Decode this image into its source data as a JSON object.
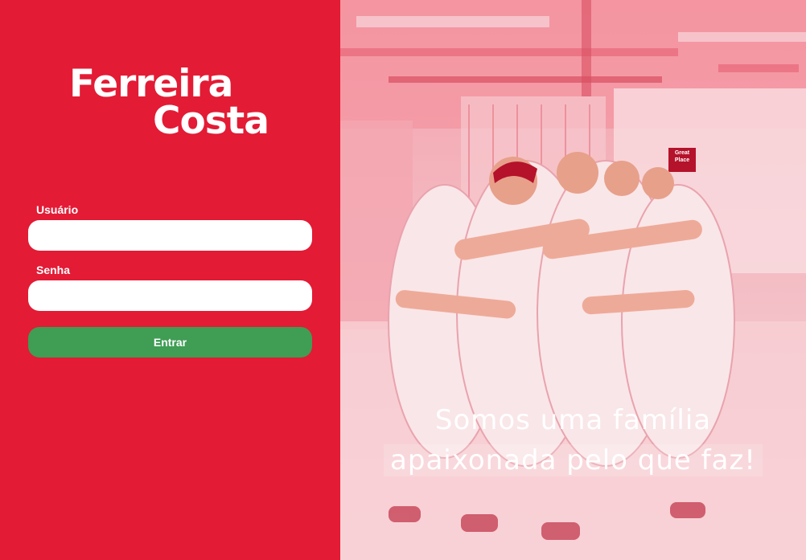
{
  "brand": {
    "logo_line1": "Ferreira",
    "logo_line2": "Costa"
  },
  "login": {
    "user_label": "Usuário",
    "user_value": "",
    "password_label": "Senha",
    "password_value": "",
    "submit_label": "Entrar"
  },
  "hero": {
    "slogan_line1": "Somos uma família",
    "slogan_line2": "apaixonada pelo que faz!",
    "sign_text": "Great Place"
  },
  "colors": {
    "brand_red": "#e31b35",
    "button_green": "#3f9d54",
    "input_bg": "#ffffff"
  }
}
